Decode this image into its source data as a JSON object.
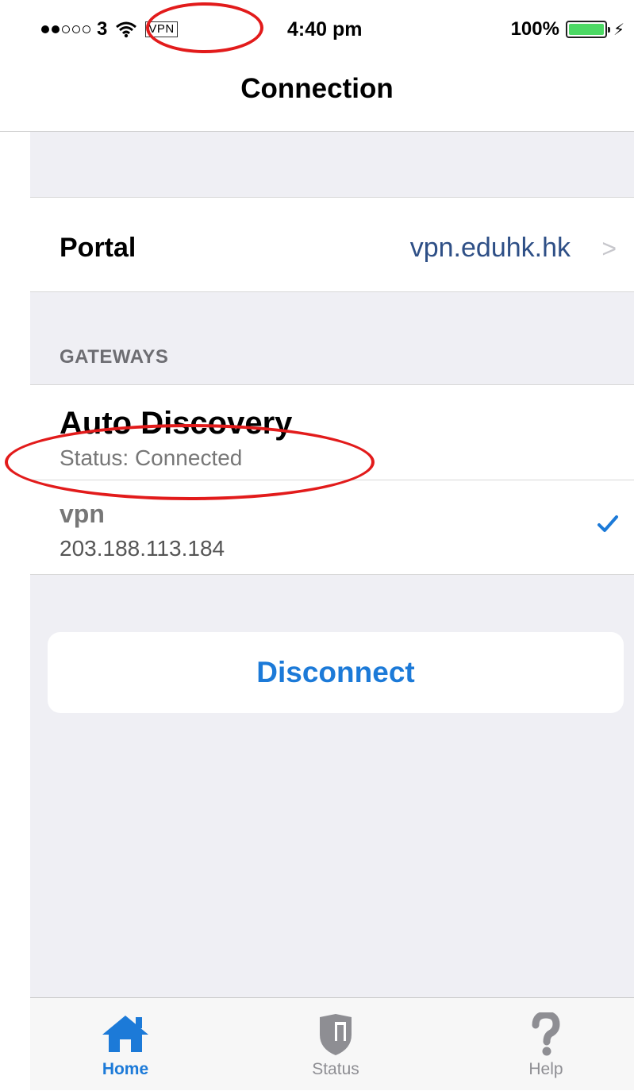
{
  "status_bar": {
    "carrier": "3",
    "vpn_indicator": "VPN",
    "time": "4:40 pm",
    "battery_percent": "100%",
    "battery_level": 1.0,
    "signal_bars_filled": 2,
    "signal_bars_total": 5,
    "battery_color": "#4cd964"
  },
  "nav": {
    "title": "Connection"
  },
  "portal": {
    "label": "Portal",
    "value": "vpn.eduhk.hk"
  },
  "gateways": {
    "header": "GATEWAYS",
    "auto": {
      "title": "Auto Discovery",
      "status": "Status: Connected"
    },
    "items": [
      {
        "name": "vpn",
        "address": "203.188.113.184",
        "selected": true
      }
    ]
  },
  "actions": {
    "disconnect_label": "Disconnect"
  },
  "tabs": [
    {
      "label": "Home",
      "icon": "home-icon",
      "active": true
    },
    {
      "label": "Status",
      "icon": "shield-icon",
      "active": false
    },
    {
      "label": "Help",
      "icon": "question-icon",
      "active": false
    }
  ],
  "colors": {
    "accent": "#1c7ad8",
    "annotation": "#e21b1b",
    "link": "#2e4f86"
  }
}
